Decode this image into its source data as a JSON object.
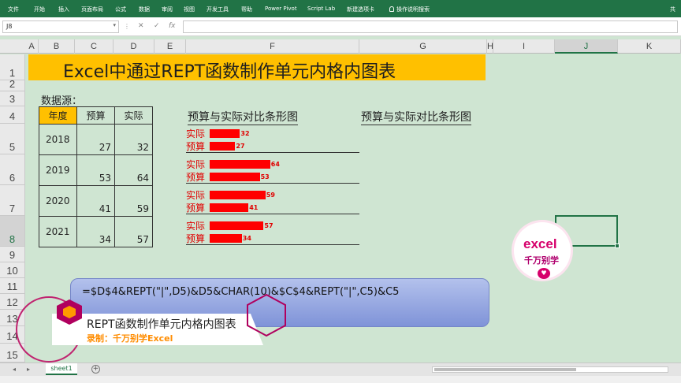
{
  "ribbon": {
    "tabs": [
      "文件",
      "开始",
      "插入",
      "页面布局",
      "公式",
      "数据",
      "审阅",
      "视图",
      "开发工具",
      "帮助",
      "Power Pivot",
      "Script Lab",
      "新建选项卡"
    ],
    "tell_me": "操作说明搜索",
    "share": "共"
  },
  "formula_bar": {
    "name_box": "J8",
    "cancel": "✕",
    "enter": "✓",
    "fx": "fx"
  },
  "columns": [
    "A",
    "B",
    "C",
    "D",
    "E",
    "F",
    "G",
    "H",
    "I",
    "J",
    "K"
  ],
  "selected_column": "J",
  "rows": [
    "1",
    "2",
    "3",
    "4",
    "5",
    "6",
    "7",
    "8",
    "9",
    "10",
    "11",
    "12",
    "13",
    "14",
    "15"
  ],
  "selected_row": "8",
  "sheet": {
    "title": "Excel中通过REPT函数制作单元内格内图表",
    "data_source_label": "数据源：",
    "table": {
      "headers": [
        "年度",
        "预算",
        "实际"
      ],
      "rows": [
        {
          "year": "2018",
          "budget": "27",
          "actual": "32"
        },
        {
          "year": "2019",
          "budget": "53",
          "actual": "64"
        },
        {
          "year": "2020",
          "budget": "41",
          "actual": "59"
        },
        {
          "year": "2021",
          "budget": "34",
          "actual": "57"
        }
      ]
    },
    "chart_title_f": "预算与实际对比条形图",
    "chart_title_g": "预算与实际对比条形图",
    "bar_rows": [
      {
        "actual_label": "实际",
        "actual": 32,
        "actual_text": "32",
        "budget_label": "预算",
        "budget": 27,
        "budget_text": "27"
      },
      {
        "actual_label": "实际",
        "actual": 64,
        "actual_text": "64",
        "budget_label": "预算",
        "budget": 53,
        "budget_text": "53"
      },
      {
        "actual_label": "实际",
        "actual": 59,
        "actual_text": "59",
        "budget_label": "预算",
        "budget": 41,
        "budget_text": "41"
      },
      {
        "actual_label": "实际",
        "actual": 57,
        "actual_text": "57",
        "budget_label": "预算",
        "budget": 34,
        "budget_text": "34"
      }
    ],
    "formula_note": "=$D$4&REPT(\"|\",D5)&D5&CHAR(10)&$C$4&REPT(\"|\",C5)&C5"
  },
  "overlay": {
    "logo_line1": "excel",
    "logo_line2": "千万别学",
    "banner_title": "REPT函数制作单元内格内图表",
    "banner_sub": "录制：千万别学Excel"
  },
  "sheet_tabs": {
    "active": "sheet1",
    "add": "+"
  },
  "colors": {
    "ribbon": "#217346",
    "sheet_bg": "#cfe5d2",
    "header_fill": "#ffc000",
    "bar": "#ff0000"
  }
}
